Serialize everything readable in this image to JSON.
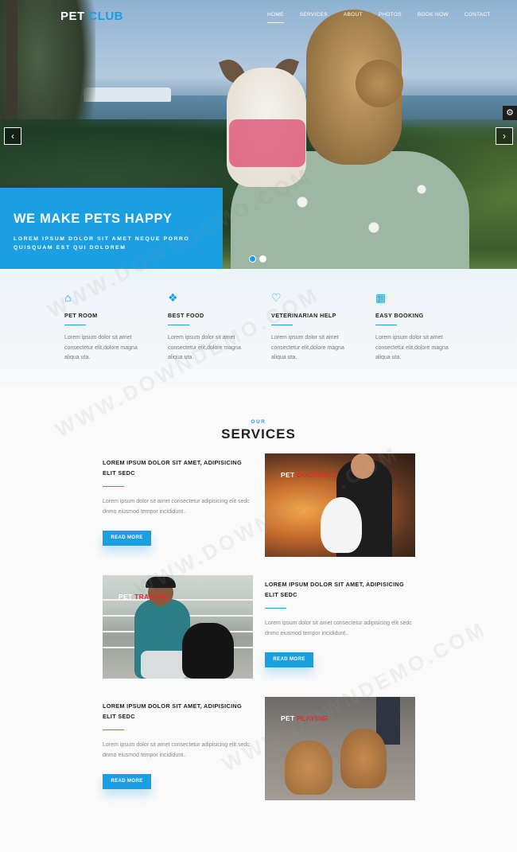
{
  "logo": {
    "part1": "PET",
    "part2": "CLUB"
  },
  "nav": [
    {
      "label": "HOME",
      "active": true
    },
    {
      "label": "SERVICES"
    },
    {
      "label": "ABOUT"
    },
    {
      "label": "PHOTOS"
    },
    {
      "label": "BOOK NOW"
    },
    {
      "label": "CONTACT"
    }
  ],
  "hero": {
    "title": "WE MAKE PETS HAPPY",
    "subtitle": "LOREM IPSUM DOLOR SIT AMET NEQUE PORRO QUISQUAM EST QUI DOLOREM",
    "prev_arrow": "‹",
    "next_arrow": "›",
    "settings_icon": "⚙"
  },
  "features": [
    {
      "icon": "home-icon",
      "glyph": "⌂",
      "title": "PET ROOM",
      "text": "Lorem ipsum dolor sit amet consectetur elit,dolore magna aliqua uta."
    },
    {
      "icon": "cubes-icon",
      "glyph": "❖",
      "title": "BEST FOOD",
      "text": "Lorem ipsum dolor sit amet consectetur elit,dolore magna aliqua uta."
    },
    {
      "icon": "heart-icon",
      "glyph": "♡",
      "title": "VETERINARIAN HELP",
      "text": "Lorem ipsum dolor sit amet consectetur elit,dolore magna aliqua uta."
    },
    {
      "icon": "calendar-icon",
      "glyph": "▦",
      "title": "EASY BOOKING",
      "text": "Lorem ipsum dolor sit amet consectetur elit,dolore magna aliqua uta."
    }
  ],
  "services_heading": {
    "small": "OUR",
    "title": "SERVICES"
  },
  "services": [
    {
      "title": "LOREM IPSUM DOLOR SIT AMET, ADIPISICING ELIT SEDC",
      "text": "Lorem ipsum dolor sit amet consectetur adipisicing elit sedc dnmo eiusmod tempor incididunt..",
      "button": "READ MORE",
      "image_caption_1": "PET",
      "image_caption_2": "GOORMING"
    },
    {
      "title": "LOREM IPSUM DOLOR SIT AMET, ADIPISICING ELIT SEDC",
      "text": "Lorem ipsum dolor sit amet consectetur adipisicing elit sedc dnmo eiusmod tempor incididunt..",
      "button": "READ MORE",
      "image_caption_1": "PET",
      "image_caption_2": "TRAINING"
    },
    {
      "title": "LOREM IPSUM DOLOR SIT AMET, ADIPISICING ELIT SEDC",
      "text": "Lorem ipsum dolor sit amet consectetur adipisicing elit sedc dnmo eiusmod tempor incididunt..",
      "button": "READ MORE",
      "image_caption_1": "PET",
      "image_caption_2": "PLAYING"
    }
  ],
  "watermark": "WWW.DOWNDEMO.COM",
  "colors": {
    "accent": "#1a9fe3",
    "caption_red": "#e02c2c",
    "dark": "#222222"
  }
}
